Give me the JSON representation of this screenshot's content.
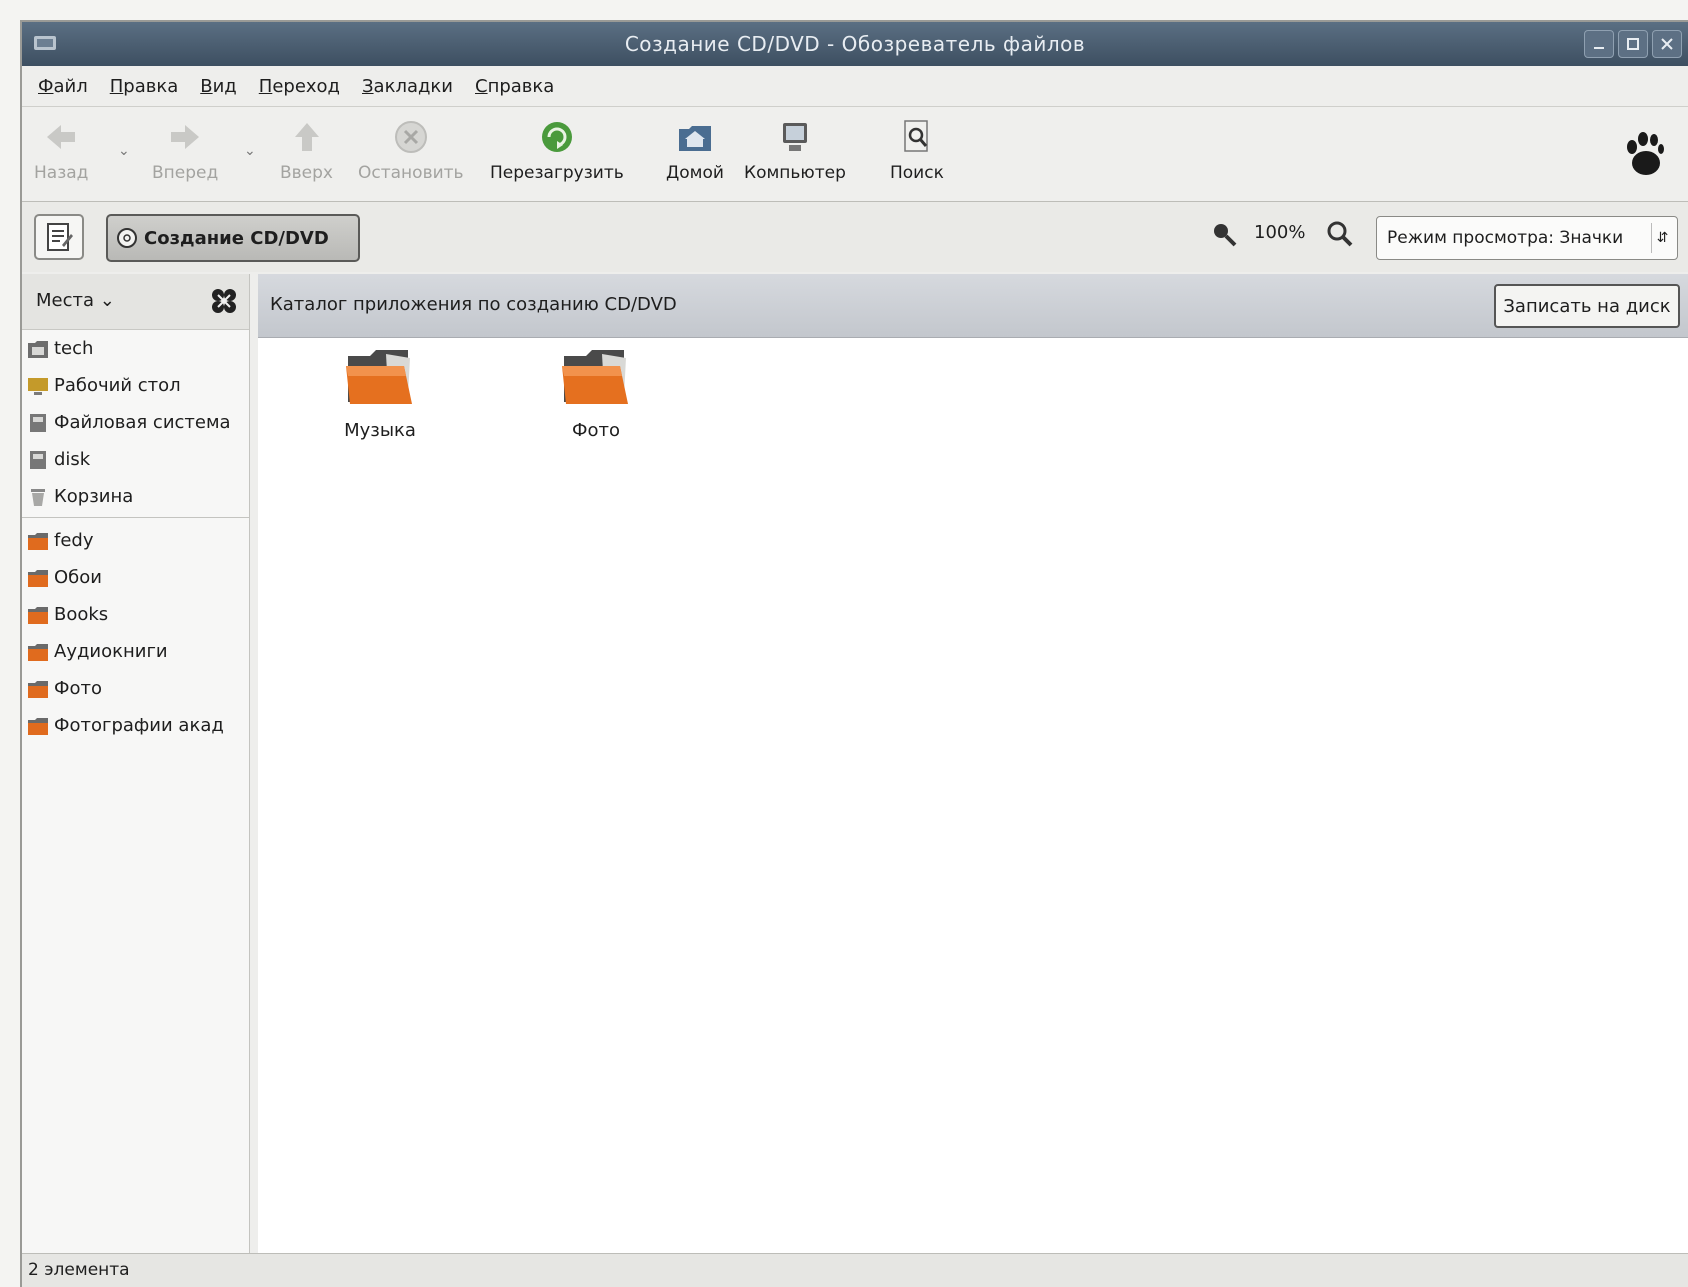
{
  "window": {
    "title": "Создание CD/DVD - Обозреватель файлов"
  },
  "menubar": [
    "Файл",
    "Правка",
    "Вид",
    "Переход",
    "Закладки",
    "Справка"
  ],
  "toolbar": {
    "back": "Назад",
    "forward": "Вперед",
    "up": "Вверх",
    "stop": "Остановить",
    "reload": "Перезагрузить",
    "home": "Домой",
    "computer": "Компьютер",
    "search": "Поиск"
  },
  "locationbar": {
    "location": "Создание CD/DVD",
    "zoom": "100%",
    "view_mode": "Режим просмотра: Значки"
  },
  "sidebar": {
    "header": "Места",
    "places": [
      "tech",
      "Рабочий стол",
      "Файловая система",
      "disk",
      "Корзина"
    ],
    "bookmarks": [
      "fedy",
      "Обои",
      "Books",
      "Аудиокниги",
      "Фото",
      "Фотографии акад"
    ]
  },
  "infobar": {
    "message": "Каталог приложения по созданию CD/DVD",
    "burn_button": "Записать на диск"
  },
  "files": [
    "Музыка",
    "Фото"
  ],
  "statusbar": "2 элемента"
}
